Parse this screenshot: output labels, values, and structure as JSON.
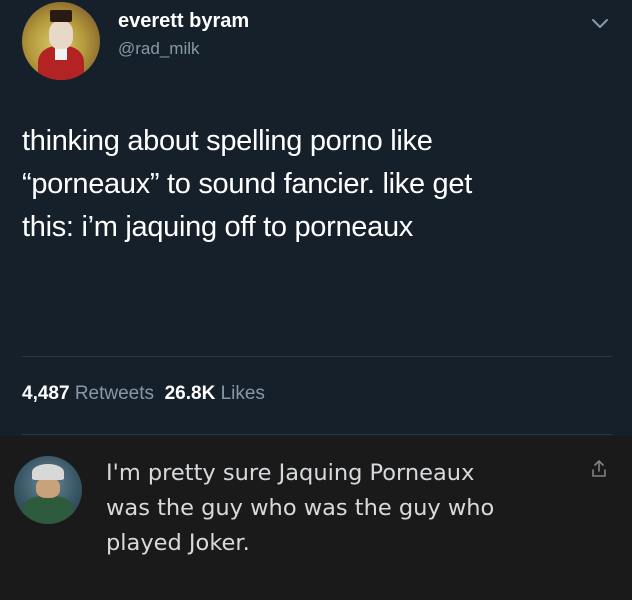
{
  "tweet": {
    "display_name": "everett byram",
    "handle": "@rad_milk",
    "text_lines": [
      "thinking about spelling porno like",
      "“porneaux” to sound fancier. like get",
      "this: i’m jaquing off to porneaux"
    ],
    "retweets_count": "4,487",
    "retweets_label": "Retweets",
    "likes_count": "26.8K",
    "likes_label": "Likes"
  },
  "reply": {
    "text_lines": [
      "I'm pretty sure Jaquing Porneaux",
      "was the guy who was the guy who",
      "played Joker."
    ]
  },
  "icons": {
    "more": "chevron-down-icon",
    "share": "share-icon"
  },
  "colors": {
    "tweet_bg": "#15202b",
    "reply_bg": "#1a1a1b",
    "secondary_text": "#8899a6"
  }
}
